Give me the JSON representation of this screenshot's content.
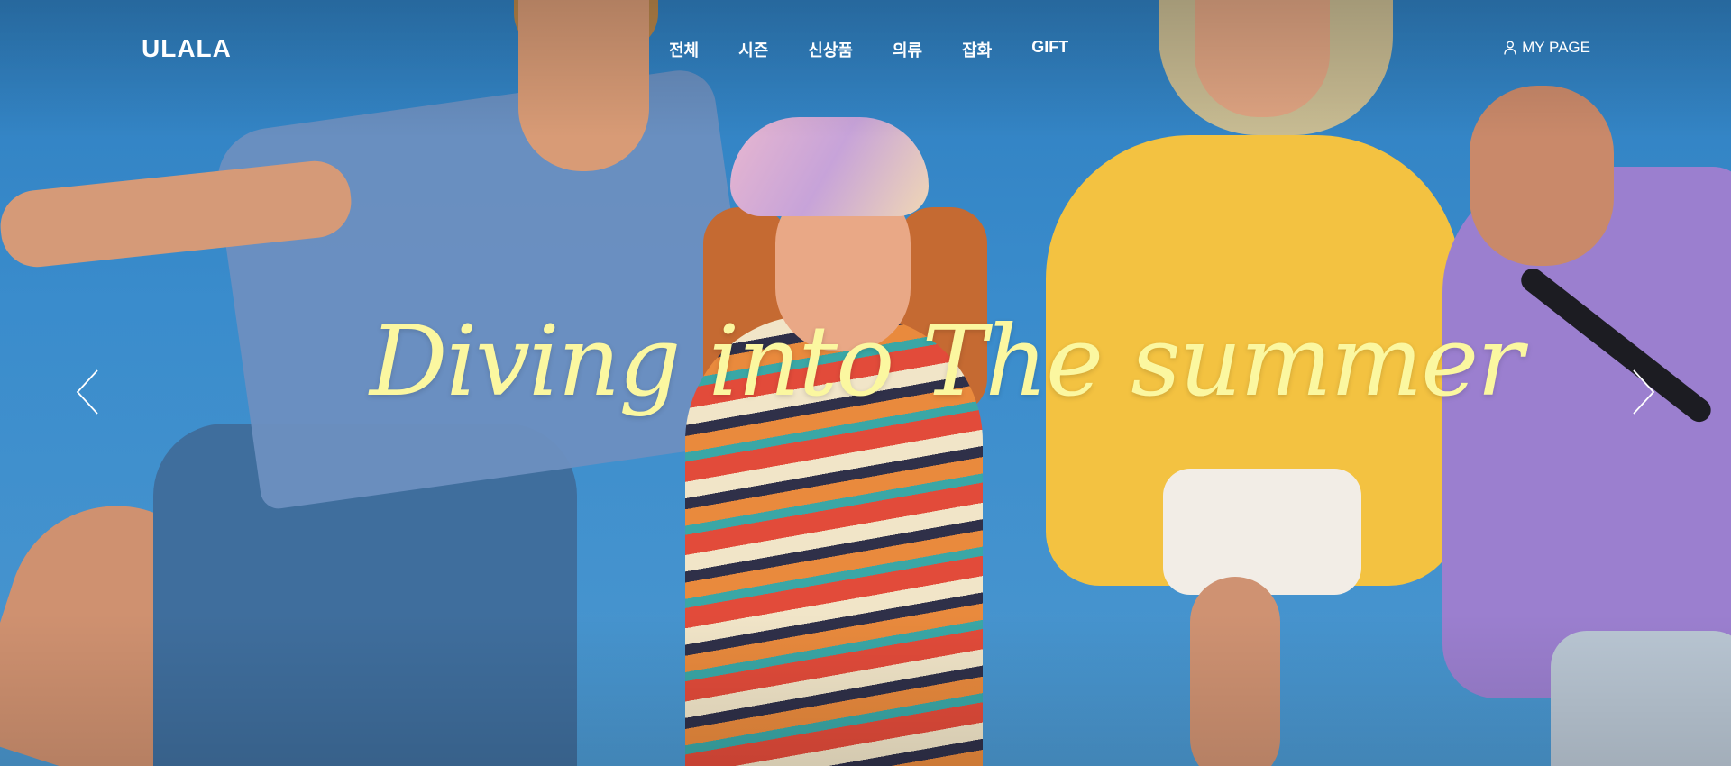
{
  "header": {
    "logo_text": "ULALA",
    "nav_items": [
      {
        "label": "전체"
      },
      {
        "label": "시즌"
      },
      {
        "label": "신상품"
      },
      {
        "label": "의류"
      },
      {
        "label": "잡화"
      },
      {
        "label": "GIFT"
      }
    ],
    "mypage_label": "MY PAGE",
    "mypage_icon": "user-icon"
  },
  "hero": {
    "slogan": "Diving into The summer",
    "slogan_color": "#fbf7a0",
    "prev_icon": "chevron-left-icon",
    "next_icon": "chevron-right-icon"
  },
  "colors": {
    "sky": "#3a8ccc",
    "text": "#ffffff"
  }
}
